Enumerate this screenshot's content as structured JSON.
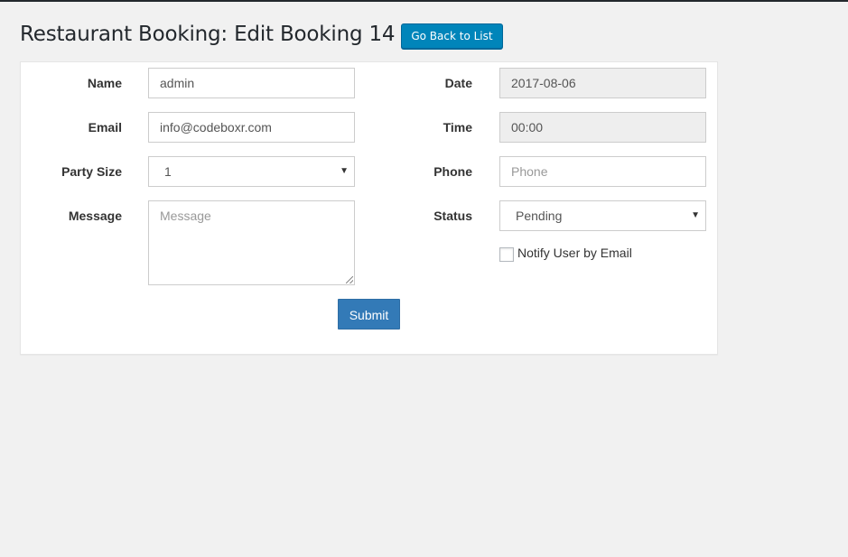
{
  "header": {
    "title": "Restaurant Booking: Edit Booking 14",
    "back_button_label": "Go Back to List"
  },
  "form": {
    "name": {
      "label": "Name",
      "value": "admin"
    },
    "email": {
      "label": "Email",
      "value": "info@codeboxr.com"
    },
    "party_size": {
      "label": "Party Size",
      "value": "1"
    },
    "message": {
      "label": "Message",
      "placeholder": "Message"
    },
    "date": {
      "label": "Date",
      "value": "2017-08-06"
    },
    "time": {
      "label": "Time",
      "value": "00:00"
    },
    "phone": {
      "label": "Phone",
      "placeholder": "Phone"
    },
    "status": {
      "label": "Status",
      "value": "Pending"
    },
    "notify": {
      "label": "Notify User by Email",
      "checked": false
    },
    "submit_label": "Submit"
  },
  "icons": {
    "select_caret": "chevron-down-icon",
    "resize": "resize-grip-icon"
  },
  "colors": {
    "back_button": "#0085ba",
    "submit_button": "#337ab7",
    "readonly_field": "#eeeeee",
    "page_background": "#f1f1f1"
  }
}
